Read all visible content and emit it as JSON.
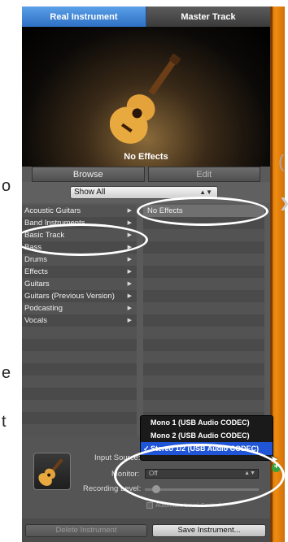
{
  "background_fragments": {
    "left_o": "o",
    "left_e": "e",
    "left_t": "t"
  },
  "header": {
    "tabs": [
      {
        "label": "Real Instrument"
      },
      {
        "label": "Master Track"
      }
    ]
  },
  "stage": {
    "patch_name": "No Effects"
  },
  "subtabs": [
    {
      "label": "Browse"
    },
    {
      "label": "Edit"
    }
  ],
  "filter": {
    "selected": "Show All"
  },
  "categories": [
    {
      "label": "Acoustic Guitars"
    },
    {
      "label": "Band Instruments"
    },
    {
      "label": "Basic Track"
    },
    {
      "label": "Bass"
    },
    {
      "label": "Drums"
    },
    {
      "label": "Effects"
    },
    {
      "label": "Guitars"
    },
    {
      "label": "Guitars (Previous Version)"
    },
    {
      "label": "Podcasting"
    },
    {
      "label": "Vocals"
    }
  ],
  "patches": [
    {
      "label": "No Effects"
    }
  ],
  "details": {
    "input_source_label": "Input Source:",
    "monitor_label": "Monitor:",
    "monitor_value": "Off",
    "recording_level_label": "Recording Level:",
    "auto_level_label": "Automatic Level Control"
  },
  "input_menu": {
    "items": [
      {
        "label": "Mono 1 (USB Audio CODEC)"
      },
      {
        "label": "Mono 2 (USB Audio CODEC)"
      },
      {
        "label": "Stereo 1/2 (USB Audio CODEC)",
        "selected": true
      }
    ]
  },
  "footer": {
    "delete_label": "Delete Instrument",
    "save_label": "Save Instrument..."
  },
  "colors": {
    "accent": "#2e6fc4",
    "menu_highlight": "#1f55d6",
    "orange": "#f08c10"
  }
}
